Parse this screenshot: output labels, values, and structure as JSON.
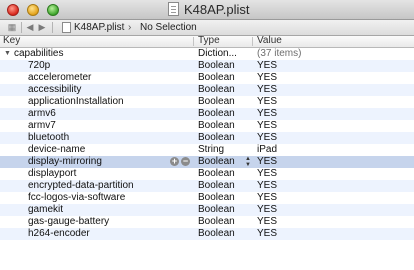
{
  "window": {
    "title": "K48AP.plist"
  },
  "navbar": {
    "file_name": "K48AP.plist",
    "selection": "No Selection"
  },
  "columns": {
    "key": "Key",
    "type": "Type",
    "value": "Value"
  },
  "parent": {
    "key": "capabilities",
    "type": "Diction...",
    "value": "(37 items)"
  },
  "rows": [
    {
      "key": "720p",
      "type": "Boolean",
      "value": "YES"
    },
    {
      "key": "accelerometer",
      "type": "Boolean",
      "value": "YES"
    },
    {
      "key": "accessibility",
      "type": "Boolean",
      "value": "YES"
    },
    {
      "key": "applicationInstallation",
      "type": "Boolean",
      "value": "YES"
    },
    {
      "key": "armv6",
      "type": "Boolean",
      "value": "YES"
    },
    {
      "key": "armv7",
      "type": "Boolean",
      "value": "YES"
    },
    {
      "key": "bluetooth",
      "type": "Boolean",
      "value": "YES"
    },
    {
      "key": "device-name",
      "type": "String",
      "value": "iPad"
    },
    {
      "key": "display-mirroring",
      "type": "Boolean",
      "value": "YES"
    },
    {
      "key": "displayport",
      "type": "Boolean",
      "value": "YES"
    },
    {
      "key": "encrypted-data-partition",
      "type": "Boolean",
      "value": "YES"
    },
    {
      "key": "fcc-logos-via-software",
      "type": "Boolean",
      "value": "YES"
    },
    {
      "key": "gamekit",
      "type": "Boolean",
      "value": "YES"
    },
    {
      "key": "gas-gauge-battery",
      "type": "Boolean",
      "value": "YES"
    },
    {
      "key": "h264-encoder",
      "type": "Boolean",
      "value": "YES"
    }
  ],
  "selected_row": "display-mirroring"
}
